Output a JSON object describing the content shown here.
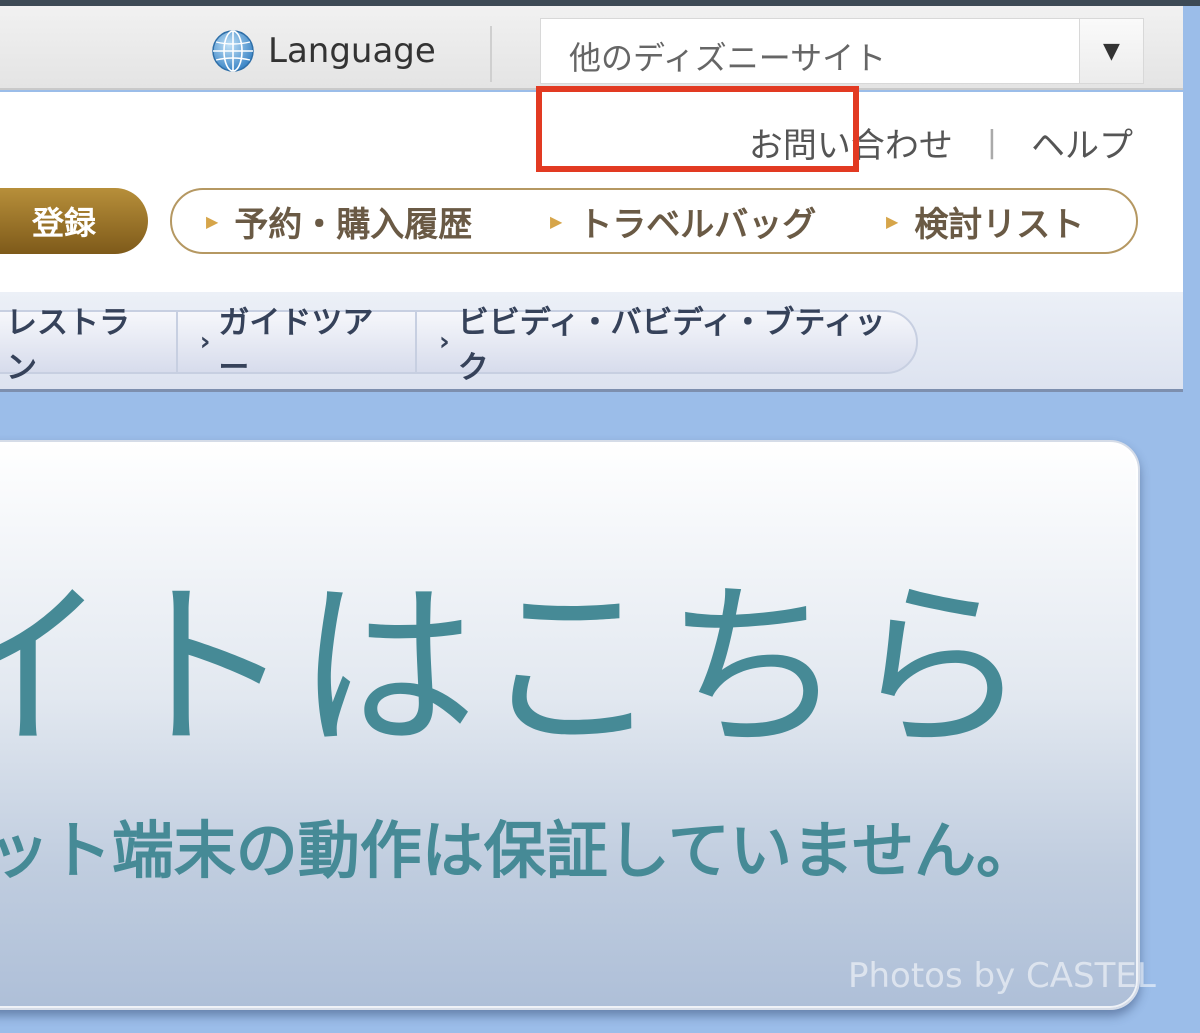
{
  "utility_bar": {
    "language_label": "Language",
    "site_select_value": "他のディズニーサイト",
    "select_arrow": "▼"
  },
  "header": {
    "links": [
      "お問い合わせ",
      "ヘルプ"
    ],
    "register_label": "登録",
    "mypage_nav": [
      "予約・購入履歴",
      "トラベルバッグ",
      "検討リスト"
    ],
    "highlighted_item": "トラベルバッグ",
    "highlight_color": "#e23a22"
  },
  "category_nav": {
    "tabs": [
      "レストラン",
      "ガイドツアー",
      "ビビディ・バビディ・ブティック"
    ]
  },
  "banner": {
    "title": "イトはこちら",
    "note": "ット端末の動作は保証していません。",
    "text_color": "#468a96"
  },
  "watermark": "Photos by CASTEL"
}
